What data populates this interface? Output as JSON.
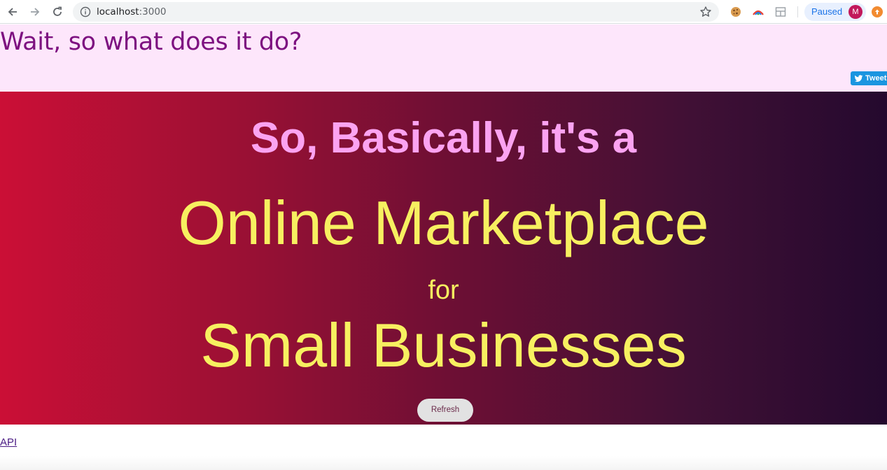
{
  "browser": {
    "url_host": "localhost",
    "url_port": ":3000",
    "profile_status": "Paused",
    "profile_initial": "M",
    "icons": [
      "back-arrow-icon",
      "forward-arrow-icon",
      "reload-icon",
      "info-icon",
      "star-icon",
      "cookie-icon",
      "arc-extension-icon",
      "layout-extension-icon",
      "update-icon"
    ]
  },
  "banner": {
    "question": "Wait, so what does it do?",
    "tweet_label": "Tweet",
    "background": "#fde6fb",
    "text_color": "#7d1180"
  },
  "hero": {
    "line1": "So, Basically, it's a",
    "line2": "Online Marketplace",
    "line3": "for",
    "line4": "Small Businesses",
    "refresh_label": "Refresh",
    "accent_pink": "#fba3f1",
    "accent_yellow": "#f7f060",
    "gradient_start": "#cb0f36",
    "gradient_end": "#24092e"
  },
  "footer": {
    "api_link": "API"
  }
}
